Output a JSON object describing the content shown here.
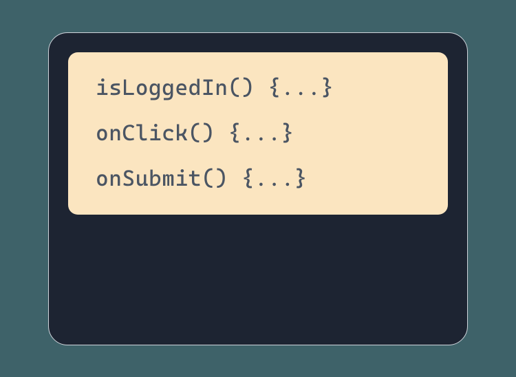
{
  "code": {
    "lines": [
      "isLoggedIn() {...}",
      "onClick() {...}",
      "onSubmit() {...}"
    ]
  }
}
